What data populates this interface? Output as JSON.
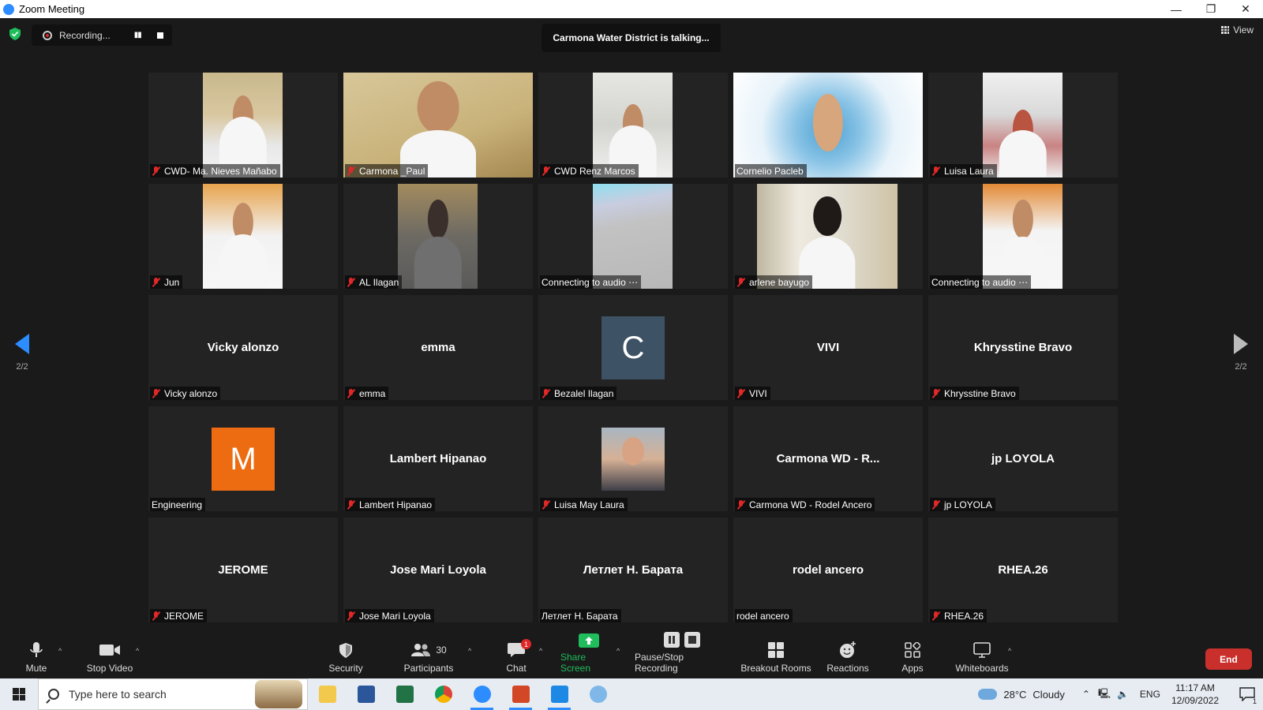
{
  "window": {
    "title": "Zoom Meeting",
    "controls": [
      "—",
      "❐",
      "✕"
    ]
  },
  "recording": {
    "label": "Recording...",
    "pause": "▮▮"
  },
  "talking_banner": "Carmona Water District is talking...",
  "view_label": "View",
  "pagination": {
    "prev": "2/2",
    "next": "2/2"
  },
  "tiles": [
    {
      "name": "CWD- Ma. Nieves Mañabo",
      "muted": true
    },
    {
      "name": "Carmona _Paul",
      "muted": true
    },
    {
      "name": "CWD Renz Marcos",
      "muted": true
    },
    {
      "name": "Cornelio Pacleb",
      "muted": false
    },
    {
      "name": "Luisa Laura",
      "muted": true
    },
    {
      "name": "Jun",
      "muted": true
    },
    {
      "name": "AL Ilagan",
      "muted": true
    },
    {
      "name": "Connecting to audio ⋯",
      "muted": false
    },
    {
      "name": "arlene bayugo",
      "muted": true
    },
    {
      "name": "Connecting to audio ⋯",
      "muted": false
    },
    {
      "name": "Vicky alonzo",
      "muted": true,
      "display": "Vicky alonzo"
    },
    {
      "name": "emma",
      "muted": true,
      "display": "emma"
    },
    {
      "name": "Bezalel Ilagan",
      "muted": true,
      "avatar": "C",
      "avatar_color": "#3e5266"
    },
    {
      "name": "VIVI",
      "muted": true,
      "display": "VIVI"
    },
    {
      "name": "Khrysstine Bravo",
      "muted": true,
      "display": "Khrysstine Bravo"
    },
    {
      "name": "Engineering",
      "muted": false,
      "avatar": "M",
      "avatar_color": "#ed6c11"
    },
    {
      "name": "Lambert Hipanao",
      "muted": true,
      "display": "Lambert Hipanao"
    },
    {
      "name": "Luisa May Laura",
      "muted": true
    },
    {
      "name": "Carmona WD - Rodel Ancero",
      "muted": true,
      "display": "Carmona WD - R..."
    },
    {
      "name": "jp LOYOLA",
      "muted": true,
      "display": "jp LOYOLA"
    },
    {
      "name": "JEROME",
      "muted": true,
      "display": "JEROME"
    },
    {
      "name": "Jose Mari Loyola",
      "muted": true,
      "display": "Jose Mari Loyola"
    },
    {
      "name": "Летлет Н. Барата",
      "muted": false,
      "display": "Летлет Н. Барата"
    },
    {
      "name": "rodel ancero",
      "muted": false,
      "display": "rodel ancero"
    },
    {
      "name": "RHEA.26",
      "muted": true,
      "display": "RHEA.26"
    }
  ],
  "toolbar": {
    "mute": "Mute",
    "stop_video": "Stop Video",
    "security": "Security",
    "participants": "Participants",
    "participants_count": "30",
    "chat": "Chat",
    "chat_badge": "1",
    "share_screen": "Share Screen",
    "pause_stop_recording": "Pause/Stop Recording",
    "breakout_rooms": "Breakout Rooms",
    "reactions": "Reactions",
    "apps": "Apps",
    "whiteboards": "Whiteboards",
    "end": "End",
    "caret": "^"
  },
  "taskbar": {
    "search_placeholder": "Type here to search",
    "weather_temp": "28°C",
    "weather_desc": "Cloudy",
    "language": "ENG",
    "time": "11:17 AM",
    "date": "12/09/2022",
    "notif_count": "1"
  },
  "colors": {
    "accent": "#2d8cff",
    "share_green": "#1fbd5c",
    "end_red": "#c9302c",
    "muted_red": "#e02828"
  }
}
